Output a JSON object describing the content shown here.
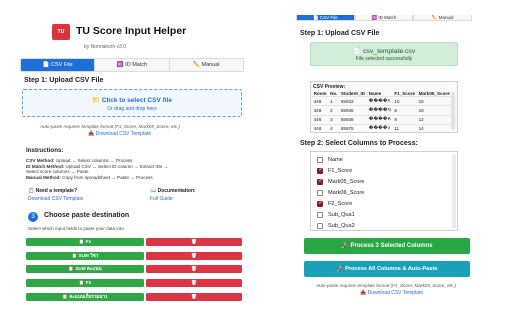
{
  "left": {
    "logo_text": "TU SCORE",
    "app_title": "TU Score Input Helper",
    "app_subtitle": "by Nonnakorn v3.0",
    "tabs": [
      {
        "label": "📄 CSV File",
        "active": true
      },
      {
        "label": "🆔 ID Match",
        "active": false
      },
      {
        "label": "✏️ Manual",
        "active": false
      }
    ],
    "step1_title": "Step 1: Upload CSV File",
    "drop_main": "📁 Click to select CSV file",
    "drop_sub": "Or drag and drop here",
    "autopaste_note": "Auto-paste requires template format (F1_Score, Mark05_Score, etc.)",
    "download_link": "📥 Download CSV Template",
    "instructions": {
      "title": "Instructions:",
      "lines": [
        {
          "bold": "CSV Method:",
          "text": " Upload → Select columns → Process"
        },
        {
          "bold": "ID Match Method:",
          "text": " Upload CSV → Select ID column → Extract IDs →"
        },
        {
          "bold": "",
          "text": "Select score columns → Paste"
        },
        {
          "bold": "Manual Method:",
          "text": " Copy from spreadsheet → Paste → Process"
        }
      ]
    },
    "help_template_title": "📋 Need a template?",
    "help_template_link": "Download CSV Template",
    "help_docs_title": "📖 Documentation:",
    "help_docs_link": "Full Guide",
    "paste_step_num": "3",
    "paste_title": "Choose paste destination",
    "paste_sub": "Select which input fields to paste your data into",
    "paste_rows": [
      {
        "label": "📋 F1",
        "delete": "🗑"
      },
      {
        "label": "📋 SUM วิชา",
        "delete": "🗑"
      },
      {
        "label": "📋 SUM คะแนน",
        "delete": "🗑"
      },
      {
        "label": "📋 F2",
        "delete": "🗑"
      },
      {
        "label": "📋 คะแนนเก็บรวมมา1",
        "delete": "🗑"
      }
    ],
    "colors": {
      "primary": "#1e6fd9",
      "green": "#2fa747",
      "red": "#dc3545"
    }
  },
  "right": {
    "tabs": [
      {
        "label": "📄 CSV File",
        "active": true
      },
      {
        "label": "🆔 ID Match",
        "active": false
      },
      {
        "label": "✏️ Manual",
        "active": false
      }
    ],
    "step1_title": "Step 1: Upload CSV File",
    "file_name": "📄 csv_template.csv",
    "file_status": "File selected successfully",
    "preview_title": "CSV Preview:",
    "preview_headers": [
      "Room",
      "No.",
      "Student_ID",
      "Name",
      "F1_Score",
      "Mark05_Score"
    ],
    "preview_rows": [
      [
        "448",
        "1",
        "65932",
        "����ก",
        "10",
        "15"
      ],
      [
        "448",
        "2",
        "65936",
        "����ข",
        "8",
        "18"
      ],
      [
        "446",
        "3",
        "65938",
        "����ค",
        "9",
        "12"
      ],
      [
        "446",
        "4",
        "65975",
        "����ง",
        "11",
        "14"
      ]
    ],
    "step2_title": "Step 2: Select Columns to Process:",
    "columns": [
      {
        "label": "Name",
        "checked": false
      },
      {
        "label": "F1_Score",
        "checked": true
      },
      {
        "label": "Mark05_Score",
        "checked": true
      },
      {
        "label": "Mark06_Score",
        "checked": false
      },
      {
        "label": "F2_Score",
        "checked": true
      },
      {
        "label": "Sub_Qua1",
        "checked": false
      },
      {
        "label": "Sub_Qua2",
        "checked": false
      }
    ],
    "process_selected_label": "🚀 Process 3 Selected Columns",
    "process_all_label": "🚀 Process All Columns & Auto-Paste",
    "autopaste_note": "Auto-paste requires template format (F1_Score, Mark05_Score, etc.)",
    "download_link": "📥 Download CSV Template",
    "colors": {
      "success_bg": "#d4edda",
      "checkbox": "#8b1a2b",
      "teal": "#17a2b8"
    }
  }
}
